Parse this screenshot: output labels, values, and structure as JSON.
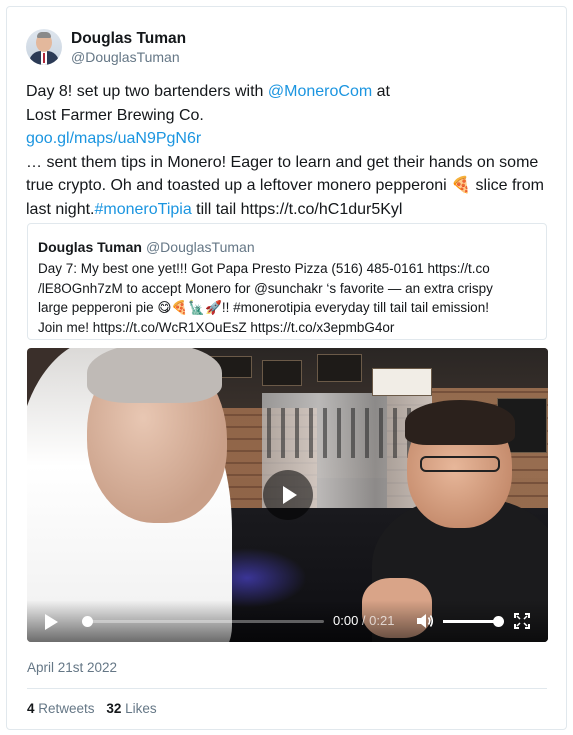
{
  "author": {
    "display_name": "Douglas Tuman",
    "handle": "@DouglasTuman"
  },
  "tweet": {
    "line1_pre": "Day 8! set up two bartenders with ",
    "line1_mention": "@MoneroCom",
    "line1_post": " at",
    "line2": "Lost Farmer Brewing Co.",
    "line3_link": "goo.gl/maps/uaN9PgN6r",
    "line4_pre": "… sent them tips in Monero! Eager to learn and get their hands on some",
    "line5_pre": "true crypto. Oh and toasted up a leftover monero pepperoni ",
    "line5_emoji": "🍕",
    "line5_post": " slice from",
    "line6_pre": "last night.",
    "line6_hashtag": "#moneroTipia",
    "line6_post": " till tail https://t.co/hC1dur5Kyl"
  },
  "quoted_tweet": {
    "display_name": "Douglas Tuman",
    "handle": "@DouglasTuman",
    "line1": "Day 7: My best one yet!!! Got Papa Presto Pizza (516) 485-0161 https://t.co",
    "line2": "/lE8OGnh7zM to accept Monero for @sunchakr ‘s favorite — an extra crispy",
    "line3": "large pepperoni pie 😋🍕🗽🚀!! #monerotipia everyday till tail tail emission!",
    "line4": "Join me! https://t.co/WcR1XOuEsZ https://t.co/x3epmbG4or"
  },
  "video": {
    "current_time": "0:00",
    "separator": " / ",
    "duration": "0:21",
    "progress": 0.0,
    "volume": 1.0,
    "icons": {
      "play": "play-icon",
      "volume": "volume-icon",
      "fullscreen": "fullscreen-icon"
    }
  },
  "meta": {
    "date": "April 21st 2022",
    "retweets_count": "4",
    "retweets_label": "Retweets",
    "likes_count": "32",
    "likes_label": "Likes"
  },
  "colors": {
    "link": "#1b95e0",
    "muted": "#657786",
    "border": "#e1e8ed"
  }
}
